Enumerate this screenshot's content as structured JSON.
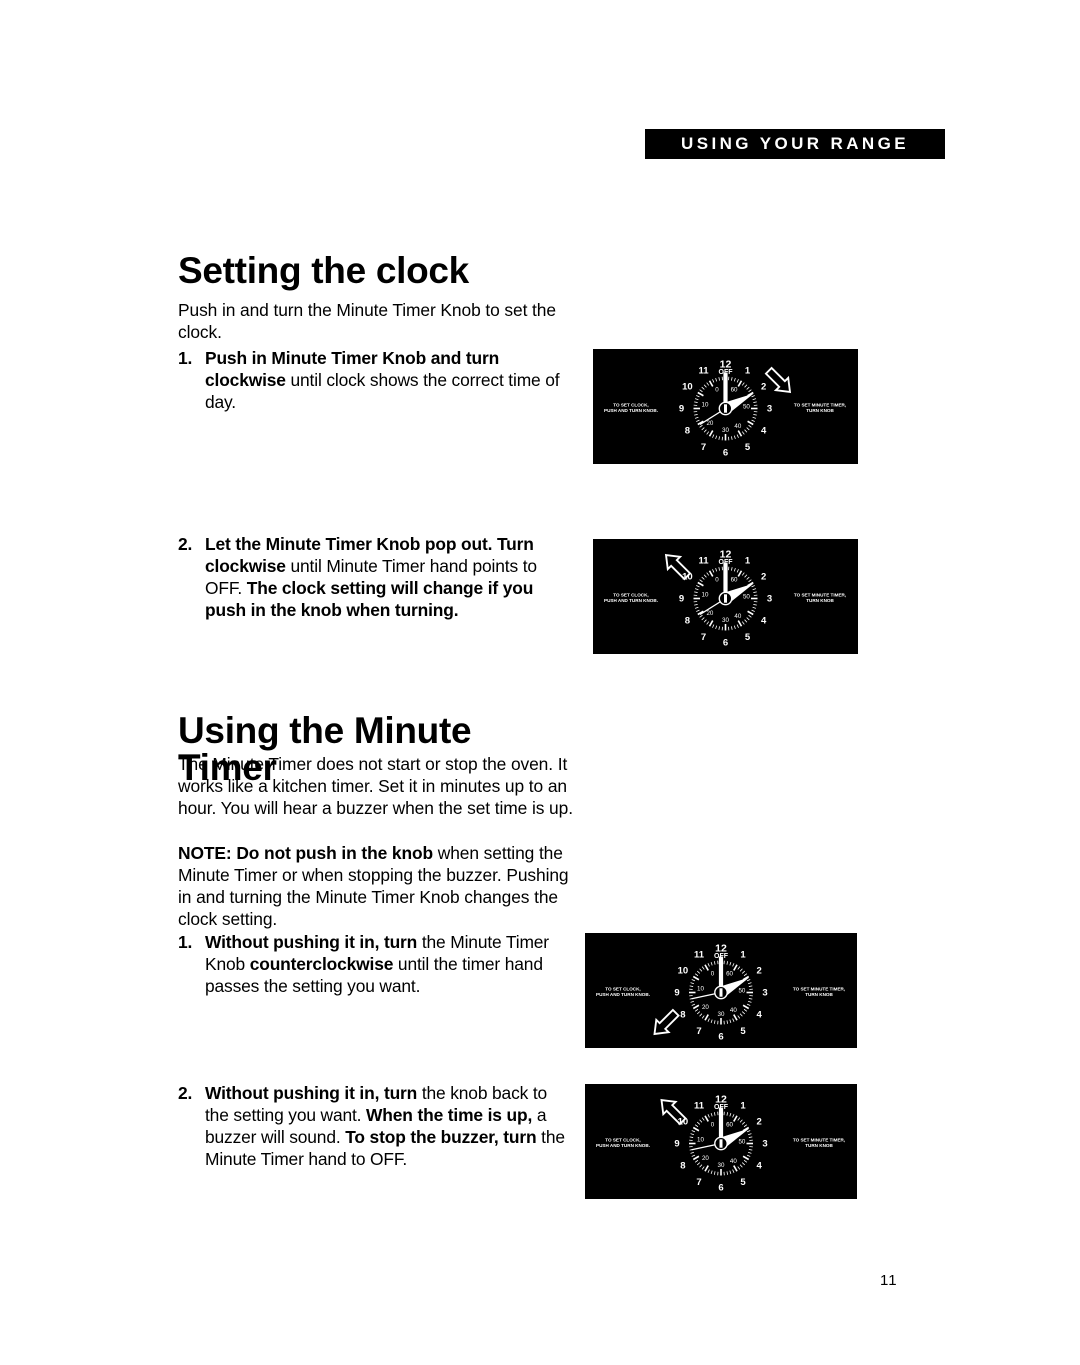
{
  "header": {
    "banner_label": "USING YOUR RANGE"
  },
  "sections": [
    {
      "title": "Setting the clock",
      "intro": "Push in and turn the Minute Timer Knob to set the clock.",
      "steps": [
        {
          "number": "1.",
          "runs": [
            {
              "text": "Push in Minute Timer Knob and turn clockwise",
              "bold": true
            },
            {
              "text": " until clock shows the correct time of day.",
              "bold": false
            }
          ]
        },
        {
          "number": "2.",
          "runs": [
            {
              "text": "Let the Minute Timer Knob pop out. Turn clockwise",
              "bold": true
            },
            {
              "text": " until Minute Timer hand points to OFF. ",
              "bold": false
            },
            {
              "text": "The clock setting will change if you push in the knob when turning.",
              "bold": true
            }
          ]
        }
      ]
    },
    {
      "title": "Using the Minute Timer",
      "intro": "The Minute Timer does not start or stop the oven. It works like a kitchen timer. Set it in minutes up to an hour. You will hear a buzzer when the set time is up.",
      "note_runs": [
        {
          "text": "NOTE: Do not push in the knob",
          "bold": true
        },
        {
          "text": " when setting the Minute Timer or when stopping the buzzer. Pushing in and turning the Minute Timer Knob changes the clock setting.",
          "bold": false
        }
      ],
      "steps": [
        {
          "number": "1.",
          "runs": [
            {
              "text": "Without pushing it in, turn",
              "bold": true
            },
            {
              "text": " the Minute Timer Knob ",
              "bold": false
            },
            {
              "text": "counterclockwise",
              "bold": true
            },
            {
              "text": " until the timer hand passes the setting you want.",
              "bold": false
            }
          ]
        },
        {
          "number": "2.",
          "runs": [
            {
              "text": "Without pushing it in, turn",
              "bold": true
            },
            {
              "text": " the knob back to the setting you want. ",
              "bold": false
            },
            {
              "text": "When the time is up,",
              "bold": true
            },
            {
              "text": " a buzzer will sound. ",
              "bold": false
            },
            {
              "text": "To stop the buzzer, turn",
              "bold": true
            },
            {
              "text": " the Minute Timer hand to OFF.",
              "bold": false
            }
          ]
        }
      ]
    }
  ],
  "clock_face": {
    "hour_numerals": [
      "12",
      "1",
      "2",
      "3",
      "4",
      "5",
      "6",
      "7",
      "8",
      "9",
      "10",
      "11"
    ],
    "minute_scale_labels": [
      "OFF",
      "60",
      "50",
      "40",
      "30",
      "20",
      "10",
      "0"
    ],
    "left_label_line1": "TO SET CLOCK,",
    "left_label_line2": "PUSH AND TURN KNOB.",
    "right_label_line1": "TO SET MINUTE TIMER,",
    "right_label_line2": "TURN KNOB",
    "panel_color": "#000000",
    "dial_color": "#ffffff"
  },
  "illustrations": [
    {
      "name": "clock-step1",
      "arrow": "clockwise-down-right",
      "caption": ""
    },
    {
      "name": "clock-step2",
      "arrow": "counterclockwise-up-left",
      "caption": ""
    },
    {
      "name": "timer-step1",
      "arrow": "counterclockwise-down-left",
      "caption": ""
    },
    {
      "name": "timer-step2",
      "arrow": "counterclockwise-up-left",
      "caption": ""
    }
  ],
  "footer": {
    "page_number": "11"
  }
}
